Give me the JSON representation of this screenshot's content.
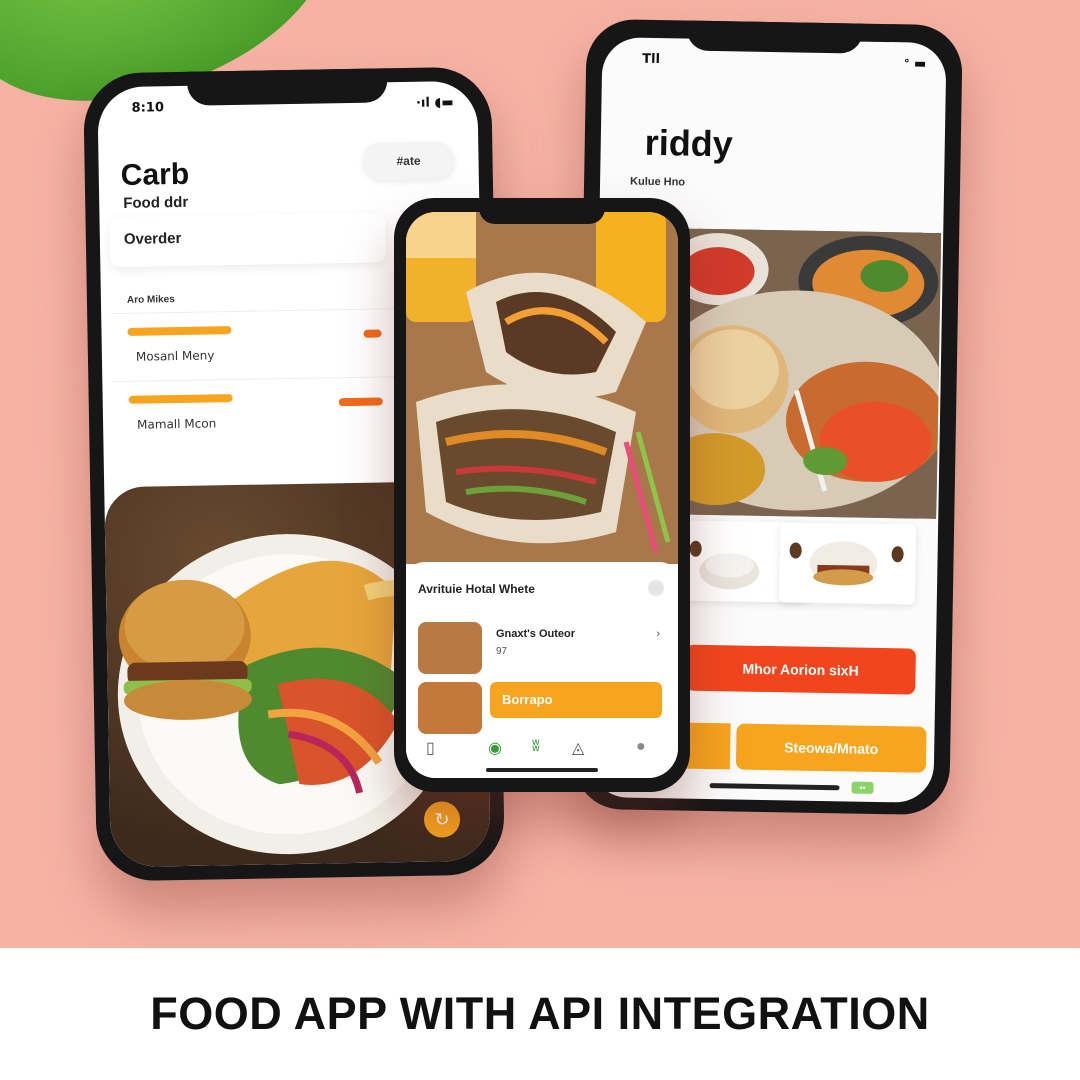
{
  "caption": "FOOD APP WITH API INTEGRATION",
  "colors": {
    "background": "#f6b3a4",
    "accent_orange": "#f7a41e",
    "accent_red": "#f2451d",
    "leaf_green": "#4da32c"
  },
  "phone_left": {
    "status_time": "8:10",
    "status_icons": "·ıl ◖▬",
    "title": "Carb",
    "subtitle": "Food ddr",
    "pill": "#ate",
    "order_label": "Overder",
    "section_label": "Aro Mikes",
    "rows": [
      {
        "label": "Mosanl Meny"
      },
      {
        "label": "Mamall Mcon"
      }
    ],
    "fab_icon": "refresh-icon"
  },
  "phone_center": {
    "card_title": "Avrituie Hotal Whete",
    "item_title": "Gnaxt's Outeor",
    "item_subtitle": "97",
    "item_more": "›",
    "button_label": "Borrapo",
    "nav_icons": [
      "copy-icon",
      "salad-icon",
      "leaf-icon",
      "bookmark-icon",
      "pin-icon"
    ]
  },
  "phone_right": {
    "status_time": "Tll",
    "status_icons": "ᐤ ▬",
    "title": "riddy",
    "subtitle": "Kulue Hno",
    "button_primary": "Mhor Aorion sixH",
    "button_secondary": "Steowa/Mnato",
    "badge": "••"
  }
}
